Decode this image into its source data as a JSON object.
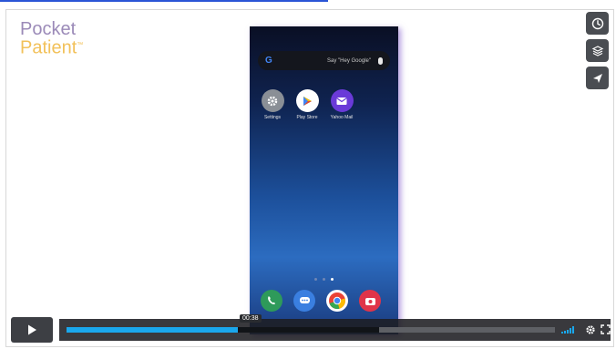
{
  "brand": {
    "line1": "Pocket",
    "line2": "Patient",
    "tm": "™"
  },
  "side_buttons": [
    "clock-icon",
    "layers-icon",
    "send-icon"
  ],
  "phone": {
    "search_placeholder": "Say \"Hey Google\"",
    "google_letter": "G",
    "apps": [
      {
        "label": "Settings",
        "icon": "settings-icon",
        "color": "#8a8f96"
      },
      {
        "label": "Play Store",
        "icon": "play-store-icon",
        "color": "#ffffff"
      },
      {
        "label": "Yahoo Mail",
        "icon": "yahoo-mail-icon",
        "color": "#6a3ad8"
      }
    ],
    "dock": [
      {
        "icon": "phone-icon",
        "color": "#2e9a5a"
      },
      {
        "icon": "messages-icon",
        "color": "#3a7fe0"
      },
      {
        "icon": "chrome-icon",
        "color": "#ffffff"
      },
      {
        "icon": "camera-icon",
        "color": "#e0344a"
      }
    ]
  },
  "controls": {
    "time_tooltip": "00:38",
    "progress": 0.35,
    "loaded": 0.64
  },
  "colors": {
    "accent": "#1aa7ec",
    "brand_purple": "#9b8ab8",
    "brand_gold": "#f2c15a"
  }
}
